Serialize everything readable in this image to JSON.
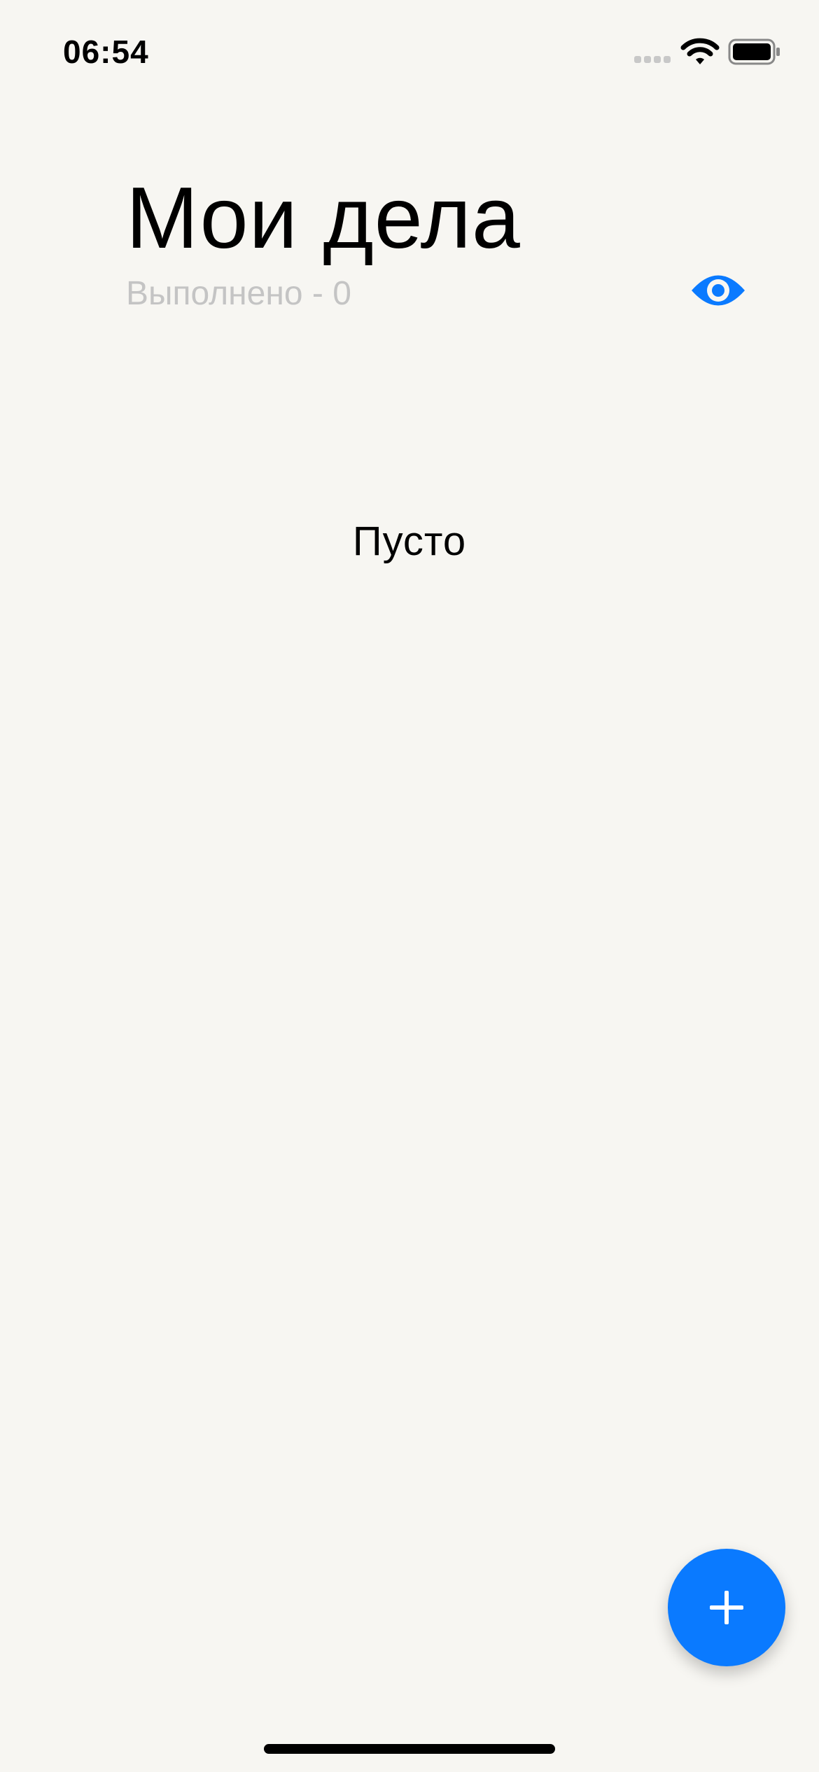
{
  "status_bar": {
    "time": "06:54",
    "icons": [
      "cellular-signal-icon",
      "wifi-icon",
      "battery-icon"
    ]
  },
  "header": {
    "title": "Мои дела",
    "done_counter": "Выполнено - 0",
    "visibility_toggle_icon": "eye-icon"
  },
  "main": {
    "empty_state_text": "Пусто"
  },
  "fab": {
    "icon": "plus-icon"
  },
  "colors": {
    "background": "#F7F6F2",
    "accent": "#0A7AFF",
    "secondary_text": "#C4C4C4",
    "primary_text": "#000000"
  }
}
